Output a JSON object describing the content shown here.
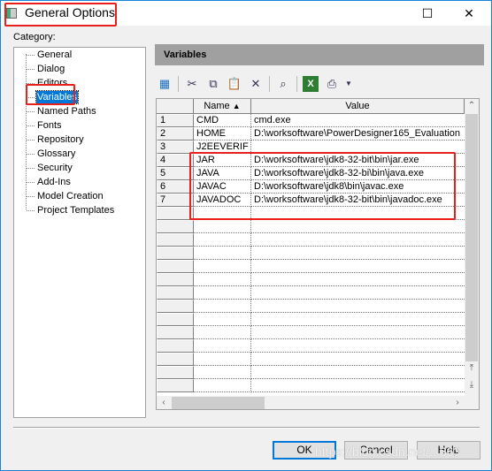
{
  "window": {
    "title": "General Options",
    "minimize": "—",
    "maximize": "☐",
    "close": "✕"
  },
  "category": {
    "label": "Category:",
    "items": [
      "General",
      "Dialog",
      "Editors",
      "Variables",
      "Named Paths",
      "Fonts",
      "Repository",
      "Glossary",
      "Security",
      "Add-Ins",
      "Model Creation",
      "Project Templates"
    ],
    "selected": "Variables"
  },
  "panel": {
    "title": "Variables"
  },
  "toolbar": {
    "icons": [
      "add-rows-icon",
      "cut-icon",
      "copy-icon",
      "paste-icon",
      "delete-icon",
      "find-icon",
      "excel-export-icon",
      "print-icon",
      "dropdown-arrow-icon"
    ]
  },
  "grid": {
    "columns": [
      "Name",
      "Value"
    ],
    "sort_indicator": "▲",
    "rows": [
      {
        "num": "1",
        "name": "CMD",
        "value": "cmd.exe"
      },
      {
        "num": "2",
        "name": "HOME",
        "value": "D:\\worksoftware\\PowerDesigner165_Evaluation"
      },
      {
        "num": "3",
        "name": "J2EEVERIF",
        "value": ""
      },
      {
        "num": "4",
        "name": "JAR",
        "value": "D:\\worksoftware\\jdk8-32-bit\\bin\\jar.exe"
      },
      {
        "num": "5",
        "name": "JAVA",
        "value": "D:\\worksoftware\\jdk8-32-bi\\bin\\java.exe"
      },
      {
        "num": "6",
        "name": "JAVAC",
        "value": "D:\\worksoftware\\jdk8\\bin\\javac.exe"
      },
      {
        "num": "7",
        "name": "JAVADOC",
        "value": "D:\\worksoftware\\jdk8-32-bit\\bin\\javadoc.exe"
      }
    ]
  },
  "buttons": {
    "ok": "OK",
    "cancel": "Cancel",
    "help": "Help"
  },
  "watermark": "https://blog.csdn.net/...363",
  "colors": {
    "selection": "#0078d7",
    "annotation": "#e8201c"
  }
}
